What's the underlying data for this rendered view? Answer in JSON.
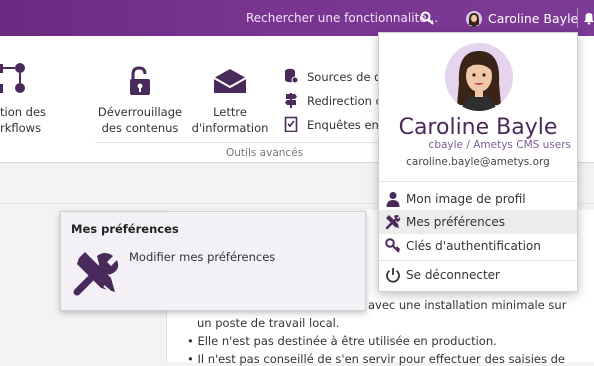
{
  "topbar": {
    "search_placeholder": "Rechercher une fonctionnalité...",
    "user_name": "Caroline Bayle"
  },
  "ribbon": {
    "workflows_label_1": "tion des",
    "workflows_label_2": "rkflows",
    "unlock_label_1": "Déverrouillage",
    "unlock_label_2": "des contenus",
    "newsletter_label_1": "Lettre",
    "newsletter_label_2": "d'information",
    "sources_label": "Sources de d",
    "redirection_label": "Redirection d",
    "surveys_label": "Enquêtes en",
    "group_label": "Outils avancés"
  },
  "tooltip": {
    "title": "Mes préférences",
    "description": "Modifier mes préférences"
  },
  "user_menu": {
    "full_name": "Caroline Bayle",
    "login": "cbayle / Ametys CMS users",
    "email": "caroline.bayle@ametys.org",
    "items": [
      {
        "label": "Mon image de profil",
        "icon": "user-icon"
      },
      {
        "label": "Mes préférences",
        "icon": "tools-icon"
      },
      {
        "label": "Clés d'authentification",
        "icon": "key-icon"
      },
      {
        "label": "Se déconnecter",
        "icon": "power-icon"
      }
    ]
  },
  "content": {
    "line1": "isée avec une installation minimale sur",
    "line2": "un poste de travail local.",
    "bullet1": "Elle n'est pas destinée à être utilisée en production.",
    "bullet2": "Il n'est pas conseillé de s'en servir pour effectuer des saisies de"
  },
  "colors": {
    "brand_purple": "#7a3492",
    "menu_name": "#4a2a5a"
  }
}
